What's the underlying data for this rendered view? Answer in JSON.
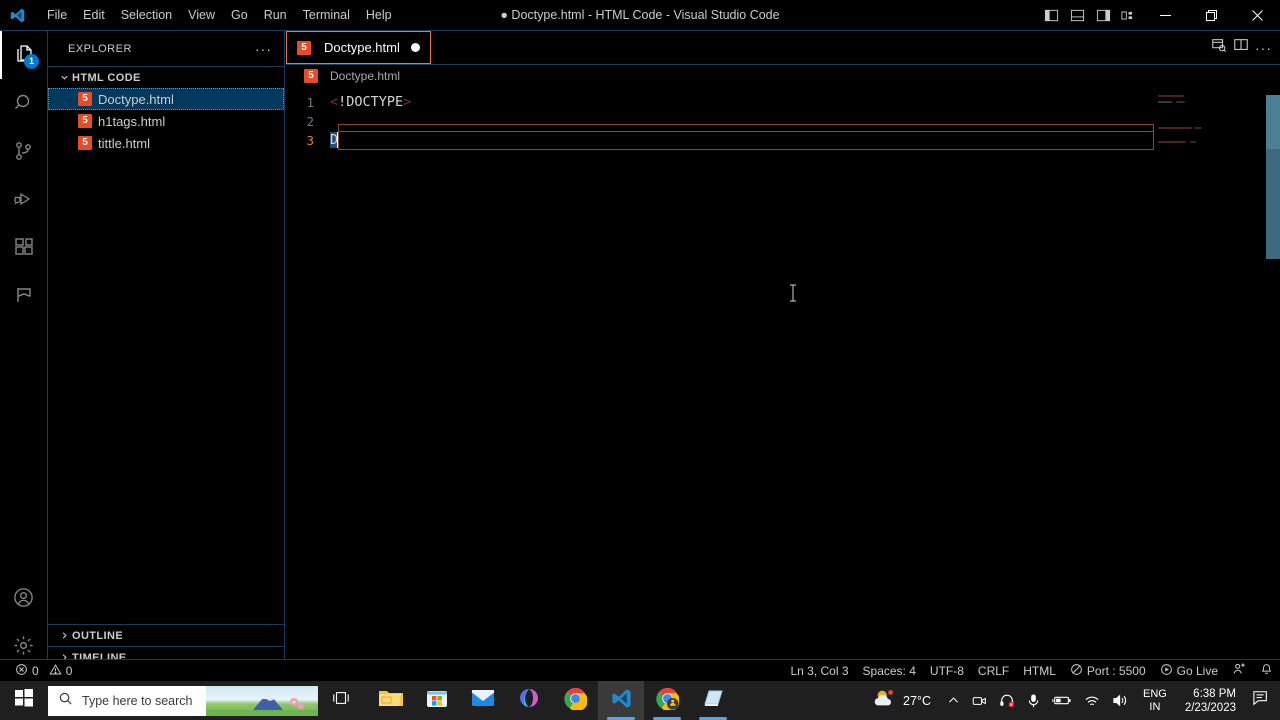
{
  "window": {
    "title": "● Doctype.html - HTML Code - Visual Studio Code",
    "logo_icon": "vscode-logo-icon"
  },
  "menubar": {
    "items": [
      {
        "label": "File",
        "name": "menu-file"
      },
      {
        "label": "Edit",
        "name": "menu-edit"
      },
      {
        "label": "Selection",
        "name": "menu-selection"
      },
      {
        "label": "View",
        "name": "menu-view"
      },
      {
        "label": "Go",
        "name": "menu-go"
      },
      {
        "label": "Run",
        "name": "menu-run"
      },
      {
        "label": "Terminal",
        "name": "menu-terminal"
      },
      {
        "label": "Help",
        "name": "menu-help"
      }
    ]
  },
  "layout_controls": [
    {
      "name": "toggle-primary-sidebar-icon",
      "title": "Toggle Primary Side Bar"
    },
    {
      "name": "toggle-panel-icon",
      "title": "Toggle Panel"
    },
    {
      "name": "toggle-secondary-sidebar-icon",
      "title": "Toggle Secondary Side Bar"
    },
    {
      "name": "customize-layout-icon",
      "title": "Customize Layout"
    }
  ],
  "window_controls": [
    {
      "name": "minimize-button",
      "glyph": "minimize"
    },
    {
      "name": "maximize-button",
      "glyph": "restore"
    },
    {
      "name": "close-button",
      "glyph": "close"
    }
  ],
  "activitybar": {
    "items": [
      {
        "name": "activity-explorer",
        "icon": "files-icon",
        "active": true,
        "badge": "1"
      },
      {
        "name": "activity-search",
        "icon": "search-icon",
        "active": false,
        "badge": ""
      },
      {
        "name": "activity-source-control",
        "icon": "source-control-icon",
        "active": false,
        "badge": ""
      },
      {
        "name": "activity-run-debug",
        "icon": "run-and-debug-icon",
        "active": false,
        "badge": ""
      },
      {
        "name": "activity-extensions",
        "icon": "extensions-icon",
        "active": false,
        "badge": ""
      },
      {
        "name": "activity-remote",
        "icon": "flag-icon",
        "active": false,
        "badge": ""
      }
    ],
    "bottom": [
      {
        "name": "activity-accounts",
        "icon": "account-icon"
      },
      {
        "name": "activity-settings",
        "icon": "gear-icon"
      }
    ]
  },
  "sidebar": {
    "title": "EXPLORER",
    "more_actions": "···",
    "folder": {
      "label": "HTML CODE",
      "expanded": true
    },
    "files": [
      {
        "label": "Doctype.html",
        "icon": "html5-file-icon",
        "selected": true
      },
      {
        "label": "h1tags.html",
        "icon": "html5-file-icon",
        "selected": false
      },
      {
        "label": "tittle.html",
        "icon": "html5-file-icon",
        "selected": false
      }
    ],
    "panels": [
      {
        "label": "OUTLINE",
        "expanded": false
      },
      {
        "label": "TIMELINE",
        "expanded": false
      }
    ]
  },
  "editor": {
    "tab": {
      "label": "Doctype.html",
      "icon": "html5-file-icon",
      "dirty": true
    },
    "actions": [
      {
        "name": "open-preview-icon"
      },
      {
        "name": "split-editor-icon"
      },
      {
        "name": "more-actions-icon",
        "label": "···"
      }
    ],
    "breadcrumb": {
      "label": "Doctype.html",
      "icon": "html5-file-icon"
    },
    "lines": [
      {
        "number": "1",
        "current": false,
        "tokens": [
          {
            "text": "<",
            "type": "bracket"
          },
          {
            "text": "!DOCTYPE",
            "type": "plain"
          },
          {
            "text": ">",
            "type": "bracket"
          }
        ]
      },
      {
        "number": "2",
        "current": false,
        "tokens": []
      },
      {
        "number": "3",
        "current": true,
        "tokens": [
          {
            "text": "D",
            "type": "selected"
          }
        ]
      }
    ]
  },
  "statusbar": {
    "left": [
      {
        "name": "status-errors",
        "icon": "error-icon",
        "label": "0"
      },
      {
        "name": "status-warnings",
        "icon": "warning-icon",
        "label": "0"
      }
    ],
    "right": [
      {
        "name": "status-cursor-position",
        "label": "Ln 3, Col 3",
        "icon": ""
      },
      {
        "name": "status-indentation",
        "label": "Spaces: 4",
        "icon": ""
      },
      {
        "name": "status-encoding",
        "label": "UTF-8",
        "icon": ""
      },
      {
        "name": "status-eol",
        "label": "CRLF",
        "icon": ""
      },
      {
        "name": "status-language-mode",
        "label": "HTML",
        "icon": ""
      },
      {
        "name": "status-live-server-port",
        "label": "Port : 5500",
        "icon": "no-entry-icon"
      },
      {
        "name": "status-go-live",
        "label": "Go Live",
        "icon": "broadcast-icon"
      },
      {
        "name": "status-feedback",
        "label": "",
        "icon": "feedback-icon"
      },
      {
        "name": "status-notifications",
        "label": "",
        "icon": "bell-icon"
      }
    ]
  },
  "taskbar": {
    "start": {
      "name": "start-button",
      "icon": "windows-logo-icon"
    },
    "search": {
      "placeholder": "Type here to search",
      "icon": "search-icon"
    },
    "task_view": {
      "name": "task-view-button",
      "icon": "task-view-icon"
    },
    "apps": [
      {
        "name": "taskbar-file-explorer",
        "icon": "file-explorer-icon",
        "state": "pinned"
      },
      {
        "name": "taskbar-microsoft-store",
        "icon": "microsoft-store-icon",
        "state": "pinned"
      },
      {
        "name": "taskbar-mail",
        "icon": "mail-icon",
        "state": "pinned"
      },
      {
        "name": "taskbar-microsoft-365",
        "icon": "microsoft-365-icon",
        "state": "pinned"
      },
      {
        "name": "taskbar-chrome",
        "icon": "chrome-icon",
        "state": "pinned"
      },
      {
        "name": "taskbar-visual-studio-code",
        "icon": "vscode-icon",
        "state": "active"
      },
      {
        "name": "taskbar-chrome-window",
        "icon": "chrome-icon",
        "state": "running"
      },
      {
        "name": "taskbar-snipping-tool",
        "icon": "snipping-tool-icon",
        "state": "running"
      }
    ],
    "tray": {
      "weather": {
        "temperature": "27°C",
        "icon": "sun-cloud-icon"
      },
      "show_hidden": {
        "name": "show-hidden-icons",
        "icon": "chevron-up-icon"
      },
      "icons": [
        {
          "name": "tray-camera",
          "icon": "camera-icon"
        },
        {
          "name": "tray-headset",
          "icon": "headset-muted-icon"
        },
        {
          "name": "tray-microphone",
          "icon": "microphone-icon"
        },
        {
          "name": "tray-battery",
          "icon": "battery-icon"
        },
        {
          "name": "tray-network",
          "icon": "wifi-icon"
        },
        {
          "name": "tray-volume",
          "icon": "speaker-icon"
        }
      ],
      "language": {
        "line1": "ENG",
        "line2": "IN"
      },
      "clock": {
        "time": "6:38 PM",
        "date": "2/23/2023"
      },
      "notifications": {
        "name": "action-center-button",
        "icon": "action-center-icon"
      }
    }
  },
  "colors": {
    "accent": "#007acc",
    "tab_border": "#e07a47",
    "html_icon": "#e44d26",
    "selection": "#264f78",
    "bracket": "#7d2f2f",
    "panel_border": "#1b3a5c"
  }
}
